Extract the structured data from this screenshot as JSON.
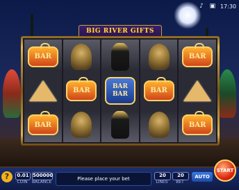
{
  "game": {
    "title": "BIG RIVER GIFTS",
    "clock": "17:30"
  },
  "top_icons": [
    "sound-icon",
    "fullscreen-icon"
  ],
  "reels": [
    [
      "BAR",
      "pyramid",
      "BAR"
    ],
    [
      "cobra",
      "BAR",
      "cobra"
    ],
    [
      "anubis",
      "BAR BAR",
      "anubis"
    ],
    [
      "cobra",
      "BAR",
      "cobra"
    ],
    [
      "BAR",
      "pyramid",
      "BAR"
    ]
  ],
  "controls": {
    "help_label": "?",
    "coin_value": "0.01",
    "coin_label": "COIN",
    "balance_value": "500000",
    "balance_label": "BALANCE",
    "message": "Please place your bet",
    "lines_value": "20",
    "lines_label": "LINES",
    "bet_value": "20",
    "bet_label": "BET",
    "auto_label": "AUTO",
    "start_label": "START"
  },
  "colors": {
    "accent": "#ffd84a",
    "start": "#e02a10",
    "panel": "#0f1a46"
  }
}
